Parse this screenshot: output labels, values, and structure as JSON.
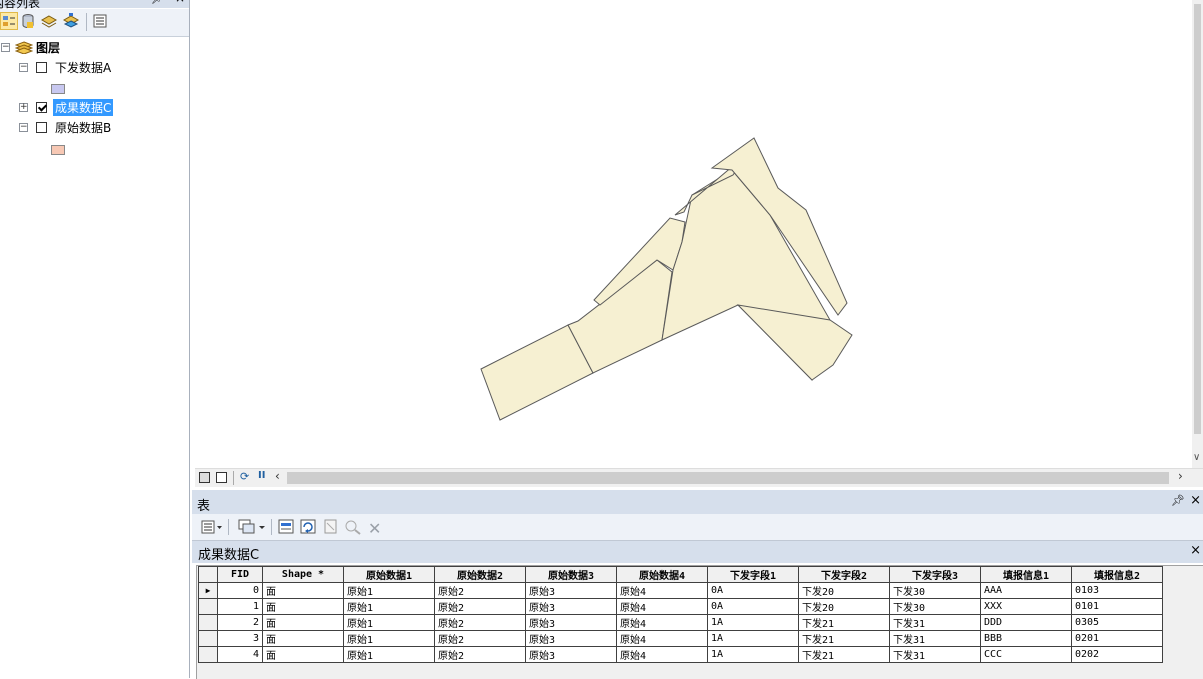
{
  "toc": {
    "title": "内容列表",
    "pin": "ꟷ",
    "close": "×",
    "root_label": "图层",
    "layers": [
      {
        "label": "下发数据A",
        "checked": false,
        "expander": "⊟",
        "swatch": "#c8c8f0"
      },
      {
        "label": "成果数据C",
        "checked": true,
        "expander": "⊞",
        "selected": true
      },
      {
        "label": "原始数据B",
        "checked": false,
        "expander": "⊟",
        "swatch": "#f7c8b4"
      }
    ]
  },
  "map": {
    "polygon_fill": "#f6f0d2",
    "polygon_stroke": "#5a5a5a"
  },
  "table_window": {
    "title": "表",
    "pin": "ꟷ",
    "close": "×",
    "tab_label": "成果数据C",
    "tab_close": "×",
    "columns": [
      "FID",
      "Shape *",
      "原始数据1",
      "原始数据2",
      "原始数据3",
      "原始数据4",
      "下发字段1",
      "下发字段2",
      "下发字段3",
      "填报信息1",
      "填报信息2"
    ],
    "rows": [
      [
        "0",
        "面",
        "原始1",
        "原始2",
        "原始3",
        "原始4",
        "0A",
        "下发20",
        "下发30",
        "AAA",
        "0103"
      ],
      [
        "1",
        "面",
        "原始1",
        "原始2",
        "原始3",
        "原始4",
        "0A",
        "下发20",
        "下发30",
        "XXX",
        "0101"
      ],
      [
        "2",
        "面",
        "原始1",
        "原始2",
        "原始3",
        "原始4",
        "1A",
        "下发21",
        "下发31",
        "DDD",
        "0305"
      ],
      [
        "3",
        "面",
        "原始1",
        "原始2",
        "原始3",
        "原始4",
        "1A",
        "下发21",
        "下发31",
        "BBB",
        "0201"
      ],
      [
        "4",
        "面",
        "原始1",
        "原始2",
        "原始3",
        "原始4",
        "1A",
        "下发21",
        "下发31",
        "CCC",
        "0202"
      ]
    ],
    "current_row_marker": "▶"
  }
}
